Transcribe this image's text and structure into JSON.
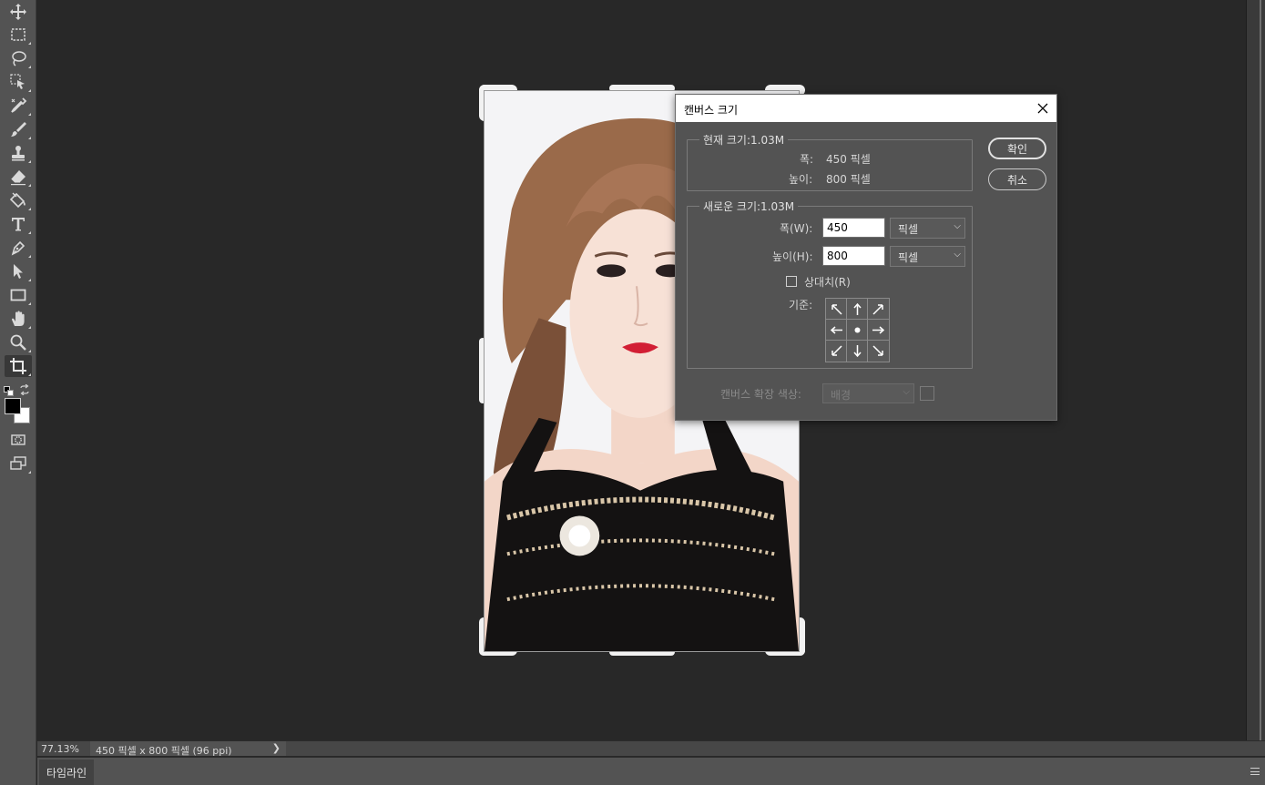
{
  "toolbar": {
    "tools": [
      {
        "name": "move-tool",
        "icon": "move-icon"
      },
      {
        "name": "marquee-tool",
        "icon": "rectangle-marquee-icon"
      },
      {
        "name": "lasso-tool",
        "icon": "lasso-icon"
      },
      {
        "name": "object-selection-tool",
        "icon": "object-selection-icon"
      },
      {
        "name": "eyedropper-tool",
        "icon": "eyedropper-icon"
      },
      {
        "name": "brush-tool",
        "icon": "brush-icon"
      },
      {
        "name": "stamp-tool",
        "icon": "clone-stamp-icon"
      },
      {
        "name": "eraser-tool",
        "icon": "eraser-icon"
      },
      {
        "name": "paint-bucket-tool",
        "icon": "paint-bucket-icon"
      },
      {
        "name": "type-tool",
        "icon": "type-icon"
      },
      {
        "name": "pen-tool",
        "icon": "pen-icon"
      },
      {
        "name": "path-selection-tool",
        "icon": "path-selection-icon"
      },
      {
        "name": "rectangle-tool",
        "icon": "rectangle-icon"
      },
      {
        "name": "hand-tool",
        "icon": "hand-icon"
      },
      {
        "name": "zoom-tool",
        "icon": "zoom-icon"
      },
      {
        "name": "crop-tool",
        "icon": "crop-icon"
      }
    ],
    "active_tool": "crop-tool",
    "foreground_color": "#000000",
    "background_color": "#ffffff"
  },
  "dialog": {
    "title": "캔버스 크기",
    "current_size": {
      "label": "현재 크기:1.03M",
      "width_label": "폭:",
      "width_value": "450 픽셀",
      "height_label": "높이:",
      "height_value": "800 픽셀"
    },
    "new_size": {
      "label": "새로운 크기:1.03M",
      "width_label": "폭(W):",
      "width_value": "450",
      "width_unit": "픽셀",
      "height_label": "높이(H):",
      "height_value": "800",
      "height_unit": "픽셀",
      "relative_label": "상대치(R)",
      "relative_checked": false,
      "anchor_label": "기준:"
    },
    "extension_color_label": "캔버스 확장 색상:",
    "extension_color_value": "배경",
    "ok_label": "확인",
    "cancel_label": "취소"
  },
  "status": {
    "zoom": "77.13%",
    "doc_info": "450 픽셀 x 800 픽셀 (96 ppi)"
  },
  "timeline": {
    "tab_label": "타임라인"
  }
}
